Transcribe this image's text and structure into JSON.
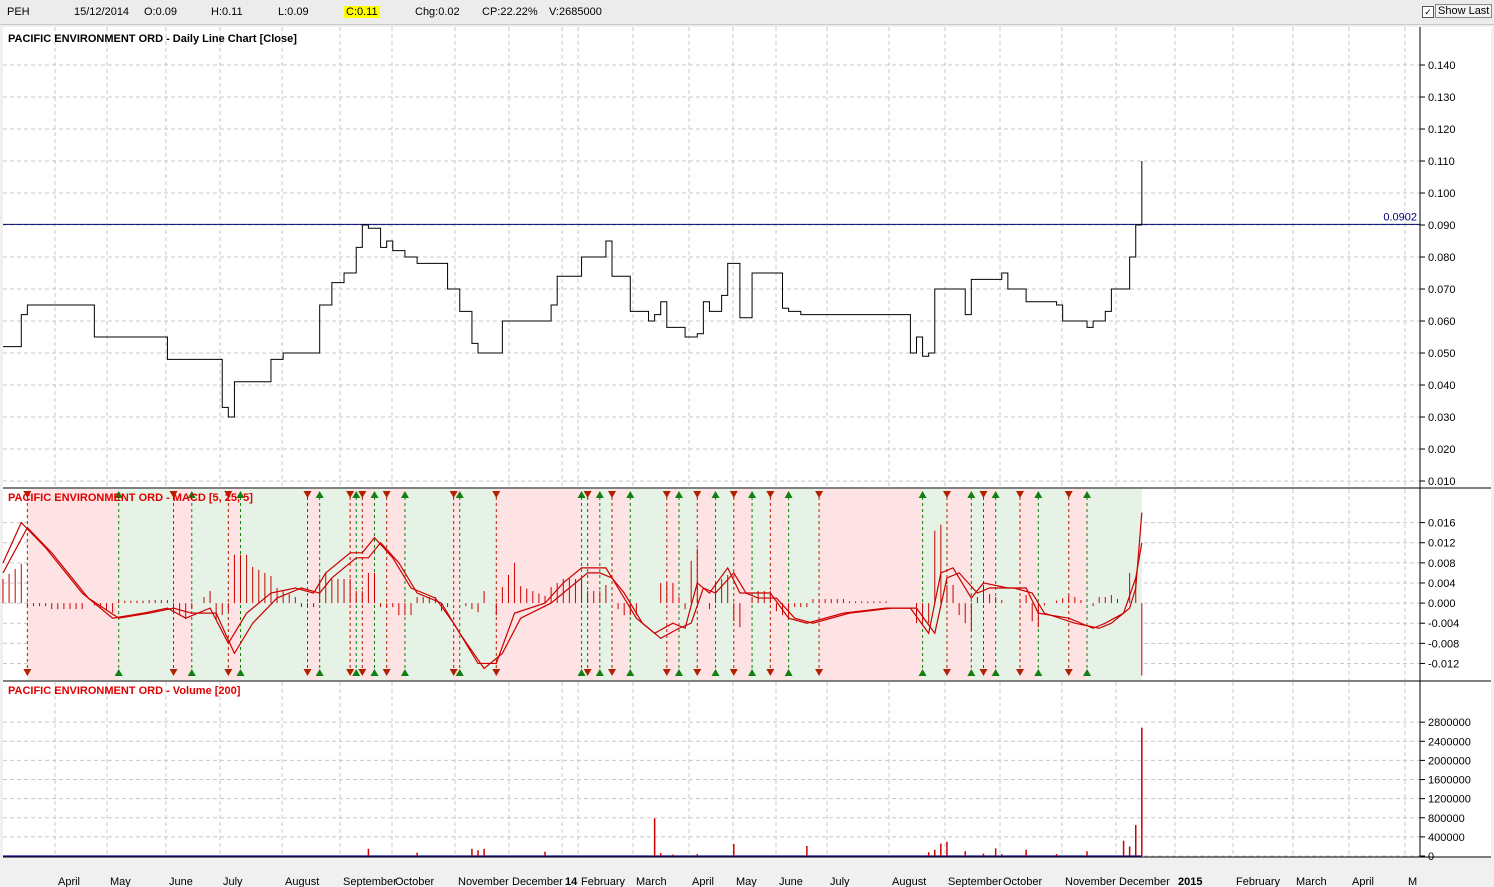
{
  "topbar": {
    "symbol": "PEH",
    "date": "15/12/2014",
    "open": "O:0.09",
    "high": "H:0.11",
    "low": "L:0.09",
    "close": "C:0.11",
    "change": "Chg:0.02",
    "change_pct": "CP:22.22%",
    "volume": "V:2685000",
    "show_last_label": "Show Last",
    "show_last_checked": true
  },
  "colors": {
    "price_line": "#000000",
    "ref_line": "#00007a",
    "macd": "#cc0000",
    "bull_shade": "#e6f2e6",
    "bear_shade": "#fde3e3",
    "up_marker": "#108010",
    "down_marker": "#b22000",
    "volume": "#cc0000",
    "volume_ma": "#1010a0"
  },
  "chart_data": [
    {
      "type": "line",
      "title": "PACIFIC ENVIRONMENT ORD - Daily Line Chart [Close]",
      "ylim": [
        0.01,
        0.145
      ],
      "yticks": [
        "0.140",
        "0.130",
        "0.120",
        "0.110",
        "0.100",
        "0.090",
        "0.080",
        "0.070",
        "0.060",
        "0.050",
        "0.040",
        "0.030",
        "0.020",
        "0.010"
      ],
      "ref_line": {
        "value": 0.0902,
        "label": "0.0902"
      },
      "x_months": [
        "April",
        "May",
        "June",
        "July",
        "August",
        "September",
        "October",
        "November",
        "December",
        "14",
        "February",
        "March",
        "April",
        "May",
        "June",
        "July",
        "August",
        "September",
        "October",
        "November",
        "December",
        "2015",
        "February",
        "March",
        "April",
        "M"
      ],
      "series": [
        {
          "points": [
            [
              0,
              0.052
            ],
            [
              2,
              0.052
            ],
            [
              3,
              0.062
            ],
            [
              4,
              0.065
            ],
            [
              14,
              0.065
            ],
            [
              15,
              0.055
            ],
            [
              26,
              0.055
            ],
            [
              27,
              0.048
            ],
            [
              35,
              0.048
            ],
            [
              36,
              0.033
            ],
            [
              37,
              0.03
            ],
            [
              38,
              0.041
            ],
            [
              43,
              0.041
            ],
            [
              44,
              0.048
            ],
            [
              46,
              0.05
            ],
            [
              51,
              0.05
            ],
            [
              52,
              0.065
            ],
            [
              54,
              0.072
            ],
            [
              56,
              0.075
            ],
            [
              58,
              0.083
            ],
            [
              59,
              0.09
            ],
            [
              60,
              0.089
            ],
            [
              62,
              0.083
            ],
            [
              63,
              0.085
            ],
            [
              64,
              0.082
            ],
            [
              66,
              0.08
            ],
            [
              68,
              0.078
            ],
            [
              72,
              0.078
            ],
            [
              73,
              0.07
            ],
            [
              74,
              0.07
            ],
            [
              75,
              0.063
            ],
            [
              77,
              0.053
            ],
            [
              78,
              0.05
            ],
            [
              81,
              0.05
            ],
            [
              82,
              0.06
            ],
            [
              89,
              0.06
            ],
            [
              90,
              0.065
            ],
            [
              91,
              0.074
            ],
            [
              94,
              0.074
            ],
            [
              95,
              0.08
            ],
            [
              98,
              0.08
            ],
            [
              99,
              0.085
            ],
            [
              100,
              0.074
            ],
            [
              102,
              0.074
            ],
            [
              103,
              0.063
            ],
            [
              106,
              0.06
            ],
            [
              107,
              0.062
            ],
            [
              108,
              0.066
            ],
            [
              109,
              0.058
            ],
            [
              110,
              0.058
            ],
            [
              112,
              0.055
            ],
            [
              114,
              0.056
            ],
            [
              115,
              0.066
            ],
            [
              116,
              0.063
            ],
            [
              118,
              0.068
            ],
            [
              119,
              0.078
            ],
            [
              120,
              0.078
            ],
            [
              121,
              0.061
            ],
            [
              123,
              0.075
            ],
            [
              127,
              0.075
            ],
            [
              128,
              0.064
            ],
            [
              129,
              0.063
            ],
            [
              131,
              0.062
            ],
            [
              148,
              0.062
            ],
            [
              149,
              0.05
            ],
            [
              150,
              0.055
            ],
            [
              151,
              0.049
            ],
            [
              152,
              0.05
            ],
            [
              153,
              0.07
            ],
            [
              157,
              0.07
            ],
            [
              158,
              0.062
            ],
            [
              159,
              0.073
            ],
            [
              163,
              0.073
            ],
            [
              164,
              0.075
            ],
            [
              165,
              0.07
            ],
            [
              168,
              0.066
            ],
            [
              173,
              0.065
            ],
            [
              174,
              0.06
            ],
            [
              178,
              0.058
            ],
            [
              179,
              0.06
            ],
            [
              181,
              0.063
            ],
            [
              182,
              0.07
            ],
            [
              184,
              0.07
            ],
            [
              185,
              0.08
            ],
            [
              186,
              0.09
            ],
            [
              187,
              0.11
            ]
          ]
        }
      ]
    },
    {
      "type": "line",
      "title": "PACIFIC ENVIRONMENT ORD - MACD [5, 25, 5]",
      "ylim": [
        -0.0135,
        0.0195
      ],
      "yticks": [
        "0.016",
        "0.012",
        "0.008",
        "0.004",
        "0.000",
        "-0.004",
        "-0.008",
        "-0.012"
      ],
      "cross_days": [
        4,
        19,
        28,
        31,
        37,
        39,
        50,
        52,
        57,
        58,
        59,
        61,
        63,
        66,
        74,
        75,
        81,
        95,
        96,
        98,
        100,
        103,
        109,
        111,
        114,
        117,
        120,
        123,
        126,
        129,
        134,
        151,
        155,
        159,
        161,
        163,
        167,
        170,
        175,
        178
      ],
      "series": [
        {
          "points": [
            [
              0,
              0.008
            ],
            [
              3,
              0.016
            ],
            [
              7,
              0.011
            ],
            [
              13,
              0.002
            ],
            [
              18,
              -0.003
            ],
            [
              23,
              -0.002
            ],
            [
              27,
              -0.001
            ],
            [
              30,
              -0.003
            ],
            [
              34,
              -0.001
            ],
            [
              37,
              -0.008
            ],
            [
              40,
              -0.002
            ],
            [
              44,
              0.002
            ],
            [
              48,
              0.003
            ],
            [
              51,
              0.002
            ],
            [
              53,
              0.006
            ],
            [
              57,
              0.01
            ],
            [
              59,
              0.01
            ],
            [
              61,
              0.013
            ],
            [
              64,
              0.009
            ],
            [
              67,
              0.003
            ],
            [
              71,
              0.001
            ],
            [
              74,
              -0.004
            ],
            [
              78,
              -0.012
            ],
            [
              81,
              -0.012
            ],
            [
              84,
              -0.002
            ],
            [
              89,
              0
            ],
            [
              92,
              0.004
            ],
            [
              95,
              0.007
            ],
            [
              97,
              0.007
            ],
            [
              99,
              0.007
            ],
            [
              101,
              0.003
            ],
            [
              104,
              -0.003
            ],
            [
              107,
              -0.006
            ],
            [
              110,
              -0.004
            ],
            [
              112,
              -0.005
            ],
            [
              114,
              0.004
            ],
            [
              116,
              0.002
            ],
            [
              119,
              0.007
            ],
            [
              121,
              0.002
            ],
            [
              123,
              0.002
            ],
            [
              126,
              0.002
            ],
            [
              129,
              -0.003
            ],
            [
              132,
              -0.004
            ],
            [
              138,
              -0.002
            ],
            [
              145,
              -0.001
            ],
            [
              149,
              -0.001
            ],
            [
              152,
              -0.006
            ],
            [
              154,
              0.006
            ],
            [
              156,
              0.007
            ],
            [
              159,
              0.001
            ],
            [
              161,
              0.004
            ],
            [
              165,
              0.003
            ],
            [
              168,
              0.003
            ],
            [
              170,
              -0.002
            ],
            [
              175,
              -0.003
            ],
            [
              179,
              -0.005
            ],
            [
              181,
              -0.004
            ],
            [
              184,
              -0.002
            ],
            [
              186,
              0.005
            ],
            [
              187,
              0.012
            ]
          ]
        },
        {
          "points": [
            [
              0,
              0.006
            ],
            [
              4,
              0.015
            ],
            [
              8,
              0.01
            ],
            [
              14,
              0.001
            ],
            [
              19,
              -0.003
            ],
            [
              24,
              -0.002
            ],
            [
              28,
              -0.001
            ],
            [
              31,
              -0.002
            ],
            [
              35,
              -0.002
            ],
            [
              38,
              -0.01
            ],
            [
              41,
              -0.004
            ],
            [
              45,
              0.001
            ],
            [
              49,
              0.003
            ],
            [
              52,
              0.002
            ],
            [
              54,
              0.005
            ],
            [
              58,
              0.009
            ],
            [
              60,
              0.009
            ],
            [
              62,
              0.012
            ],
            [
              65,
              0.008
            ],
            [
              68,
              0.002
            ],
            [
              72,
              0
            ],
            [
              75,
              -0.006
            ],
            [
              79,
              -0.013
            ],
            [
              82,
              -0.01
            ],
            [
              85,
              -0.003
            ],
            [
              90,
              0
            ],
            [
              93,
              0.003
            ],
            [
              96,
              0.006
            ],
            [
              98,
              0.006
            ],
            [
              100,
              0.005
            ],
            [
              102,
              0.002
            ],
            [
              105,
              -0.004
            ],
            [
              108,
              -0.007
            ],
            [
              111,
              -0.005
            ],
            [
              113,
              -0.004
            ],
            [
              115,
              0.003
            ],
            [
              117,
              0.002
            ],
            [
              120,
              0.006
            ],
            [
              122,
              0.002
            ],
            [
              124,
              0.001
            ],
            [
              127,
              0.001
            ],
            [
              130,
              -0.003
            ],
            [
              133,
              -0.004
            ],
            [
              139,
              -0.002
            ],
            [
              146,
              -0.001
            ],
            [
              150,
              -0.001
            ],
            [
              153,
              -0.006
            ],
            [
              155,
              0.005
            ],
            [
              157,
              0.006
            ],
            [
              160,
              0.002
            ],
            [
              162,
              0.003
            ],
            [
              166,
              0.003
            ],
            [
              169,
              0.002
            ],
            [
              171,
              -0.002
            ],
            [
              176,
              -0.004
            ],
            [
              180,
              -0.005
            ],
            [
              182,
              -0.004
            ],
            [
              185,
              -0.001
            ],
            [
              186,
              0.003
            ],
            [
              187,
              0.018
            ]
          ]
        }
      ]
    },
    {
      "type": "bar",
      "title": "PACIFIC ENVIRONMENT ORD - Volume [200]",
      "ylim": [
        0,
        2950000
      ],
      "yticks": [
        "2800000",
        "2400000",
        "2000000",
        "1600000",
        "1200000",
        "800000",
        "400000",
        "0"
      ],
      "points": [
        [
          60,
          150000
        ],
        [
          68,
          70000
        ],
        [
          77,
          150000
        ],
        [
          78,
          120000
        ],
        [
          79,
          150000
        ],
        [
          89,
          90000
        ],
        [
          107,
          790000
        ],
        [
          108,
          60000
        ],
        [
          110,
          30000
        ],
        [
          114,
          40000
        ],
        [
          120,
          250000
        ],
        [
          132,
          210000
        ],
        [
          152,
          80000
        ],
        [
          153,
          130000
        ],
        [
          154,
          260000
        ],
        [
          155,
          300000
        ],
        [
          158,
          100000
        ],
        [
          161,
          50000
        ],
        [
          163,
          160000
        ],
        [
          164,
          40000
        ],
        [
          168,
          130000
        ],
        [
          173,
          40000
        ],
        [
          178,
          100000
        ],
        [
          184,
          320000
        ],
        [
          185,
          200000
        ],
        [
          186,
          650000
        ],
        [
          187,
          2685000
        ]
      ]
    }
  ]
}
